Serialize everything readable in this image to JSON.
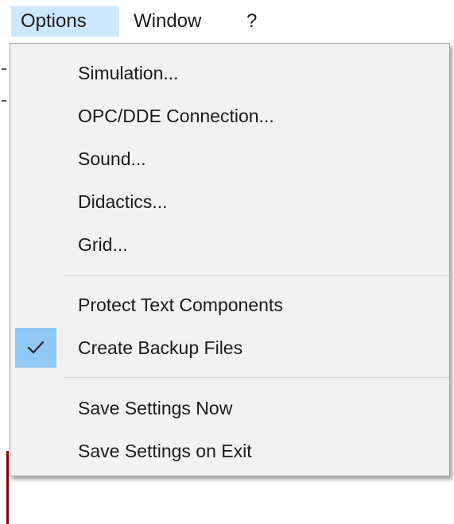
{
  "menubar": {
    "items": [
      {
        "label": "Options"
      },
      {
        "label": "Window"
      },
      {
        "label": "?"
      }
    ]
  },
  "options_menu": {
    "items": [
      {
        "label": "Simulation..."
      },
      {
        "label": "OPC/DDE Connection..."
      },
      {
        "label": "Sound..."
      },
      {
        "label": "Didactics..."
      },
      {
        "label": "Grid..."
      },
      {
        "label": "Protect Text Components",
        "checked": false
      },
      {
        "label": "Create Backup Files",
        "checked": true
      },
      {
        "label": "Save Settings Now"
      },
      {
        "label": "Save Settings on Exit"
      }
    ]
  },
  "colors": {
    "menubar_active": "#cce8ff",
    "menu_background": "#f2f2f2",
    "check_highlight": "#90c8f6"
  },
  "icons": {
    "checkmark": "checkmark-icon"
  }
}
